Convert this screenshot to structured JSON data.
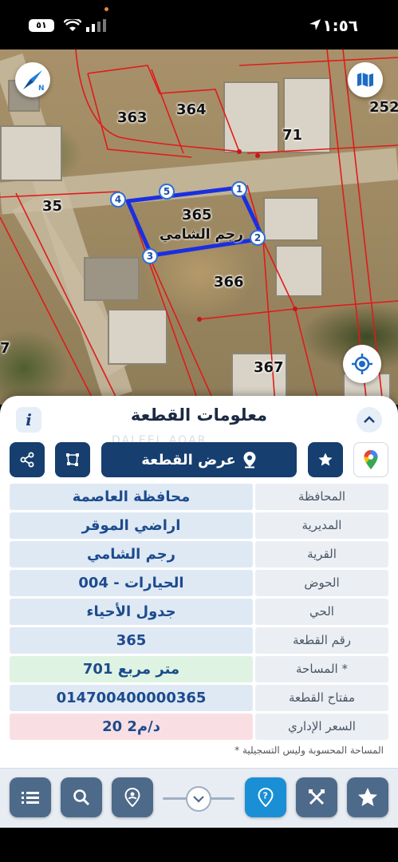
{
  "status_bar": {
    "battery": "٥١",
    "time": "١:٥٦"
  },
  "map": {
    "plots": {
      "p363": "363",
      "p364": "364",
      "p71": "71",
      "p252": "252",
      "p35": "35",
      "p365": "365",
      "p366": "366",
      "p367": "367",
      "p7": "7"
    },
    "selected_plot_name": "رجم الشامي",
    "vertices": [
      "1",
      "2",
      "3",
      "4",
      "5"
    ],
    "highlight_color": "#1a2fe0",
    "boundary_color": "#e01b1b"
  },
  "sheet": {
    "title": "معلومات القطعة",
    "watermark": "DALEEL AQAR",
    "show_plot_button": "عرض القطعة",
    "rows": [
      {
        "label": "المحافظة",
        "value": "محافظة العاصمة"
      },
      {
        "label": "المديرية",
        "value": "اراضي الموقر"
      },
      {
        "label": "القرية",
        "value": "رجم الشامي"
      },
      {
        "label": "الحوض",
        "value": "الحيارات - 004"
      },
      {
        "label": "الحي",
        "value": "جدول الأحياء"
      },
      {
        "label": "رقم القطعة",
        "value": "365"
      },
      {
        "label": "المساحة *",
        "value": "701  متر مربع"
      },
      {
        "label": "مفتاح القطعة",
        "value": "014700400000365"
      },
      {
        "label": "السعر الإداري",
        "value": "20 د/م2"
      }
    ],
    "note": "* المساحة المحسوبة وليس التسجيلية"
  },
  "colors": {
    "accent_dark": "#163e6e",
    "accent_active": "#1a8fd6",
    "value_text": "#1c4b8e"
  }
}
